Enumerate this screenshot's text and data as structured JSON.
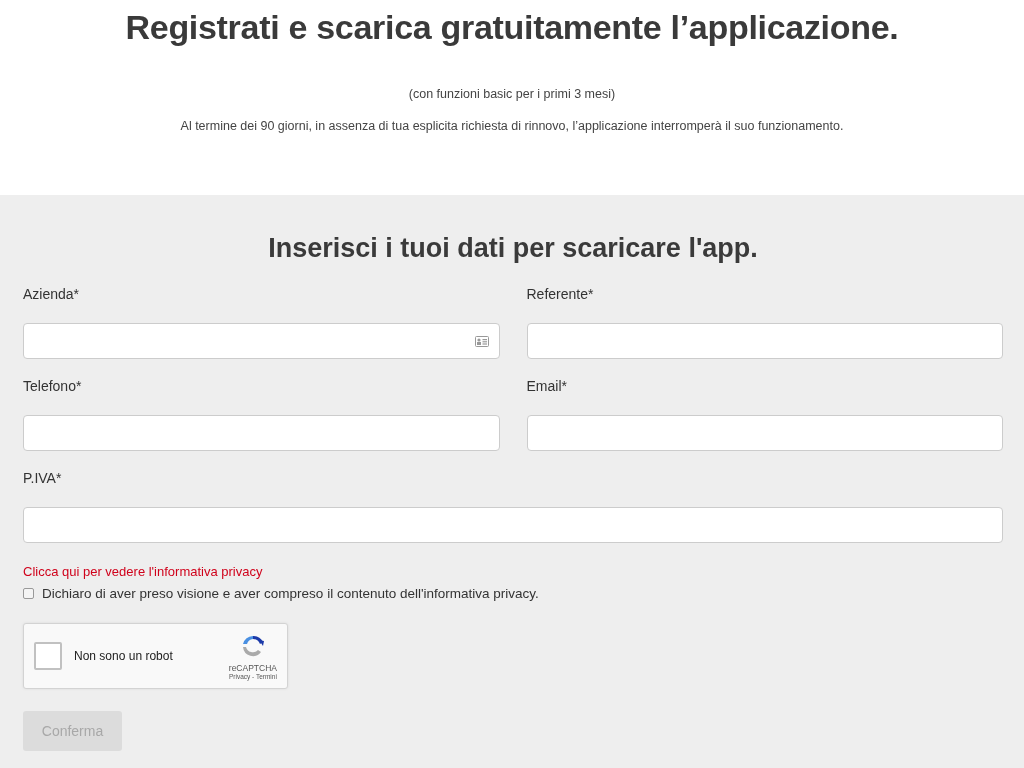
{
  "header": {
    "title": "Registrati e scarica gratuitamente l’applicazione.",
    "subtitle": "(con funzioni basic per i primi 3 mesi)",
    "notice": "Al termine dei 90 giorni, in assenza di tua esplicita richiesta di rinnovo, l’applicazione interromperà il suo funzionamento."
  },
  "form": {
    "title": "Inserisci i tuoi dati per scaricare l'app.",
    "fields": [
      {
        "label": "Azienda*",
        "wide": false,
        "autofill": true
      },
      {
        "label": "Referente*",
        "wide": false,
        "autofill": false
      },
      {
        "label": "Telefono*",
        "wide": false,
        "autofill": false
      },
      {
        "label": "Email*",
        "wide": false,
        "autofill": false
      },
      {
        "label": "P.IVA*",
        "wide": true,
        "autofill": false
      }
    ],
    "privacy_link": "Clicca qui per vedere l'informativa privacy",
    "consent": {
      "label": "Dichiaro di aver preso visione e aver compreso il contenuto dell'informativa privacy.",
      "checked": false
    },
    "captcha": {
      "label": "Non sono un robot",
      "checked": false,
      "brand": "reCAPTCHA",
      "links": "Privacy - Termini"
    },
    "submit": {
      "label": "Conferma",
      "disabled": true
    }
  }
}
